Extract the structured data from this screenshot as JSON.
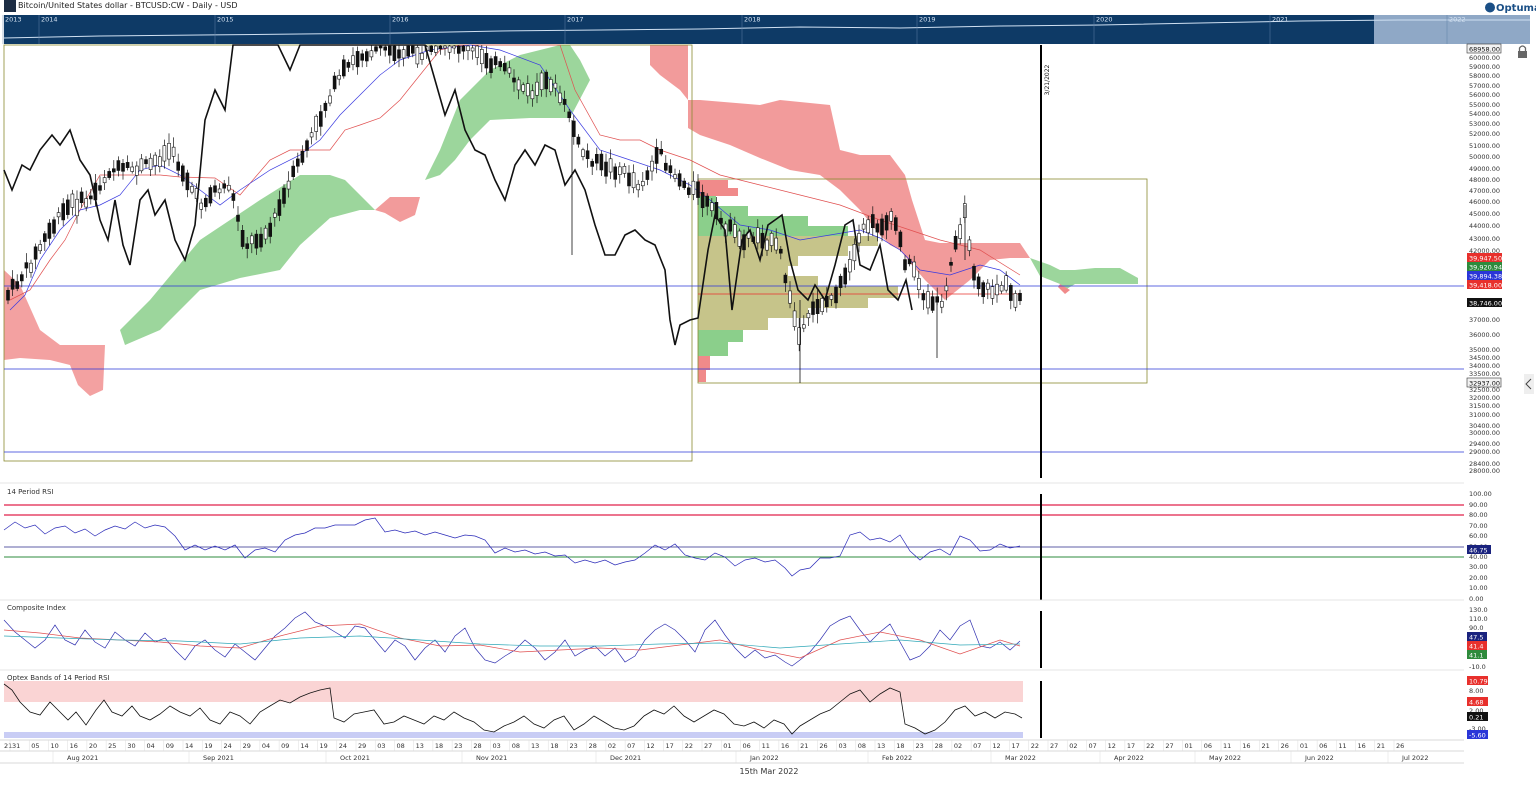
{
  "header": {
    "title": "Bitcoin/United States dollar - BTCUSD:CW - Daily - USD",
    "brand": "Optuma"
  },
  "navigator": {
    "years": [
      "2013",
      "2014",
      "2015",
      "2016",
      "2017",
      "2018",
      "2019",
      "2020",
      "2021",
      "2022"
    ]
  },
  "price_panel": {
    "vline_label": "3/21/2022",
    "top_label": "68958.00",
    "box_low_label": "32937.00",
    "price_ticks": [
      "60000.00",
      "59000.00",
      "58000.00",
      "57000.00",
      "56000.00",
      "55000.00",
      "54000.00",
      "53000.00",
      "52000.00",
      "51000.00",
      "50000.00",
      "49000.00",
      "48000.00",
      "47000.00",
      "46000.00",
      "45000.00",
      "44000.00",
      "43000.00",
      "42000.00",
      "37000.00",
      "36000.00",
      "35000.00",
      "34500.00",
      "34000.00",
      "33500.00",
      "32500.00",
      "32000.00",
      "31500.00",
      "31000.00",
      "30400.00",
      "30000.00",
      "29400.00",
      "29000.00",
      "28400.00",
      "28000.00"
    ],
    "markers": [
      {
        "value": "39,947.50",
        "color": "#e8302c"
      },
      {
        "value": "39,920.94",
        "color": "#2e8b3c"
      },
      {
        "value": "39,894.38",
        "color": "#2a36d8"
      },
      {
        "value": "39,418.00",
        "color": "#e8302c"
      },
      {
        "value": "38,746.00",
        "color": "#111111"
      }
    ]
  },
  "rsi_panel": {
    "title": "14 Period RSI",
    "ticks": [
      "100.00",
      "90.00",
      "80.00",
      "70.00",
      "60.00",
      "50.00",
      "40.00",
      "30.00",
      "20.00",
      "10.00",
      "0.00"
    ],
    "marker": "46.75"
  },
  "composite_panel": {
    "title": "Composite Index",
    "ticks": [
      "130.0",
      "110.0",
      "90.0",
      "70.0",
      "50.0",
      "30.0",
      "10.0",
      "-10.0"
    ],
    "markers": [
      {
        "value": "47.5",
        "color": "#1a237e"
      },
      {
        "value": "41.4",
        "color": "#e8302c"
      },
      {
        "value": "41.1",
        "color": "#2e8b3c"
      }
    ]
  },
  "optex_panel": {
    "title": "Optex Bands of 14 Period RSI",
    "ticks": [
      "8.00",
      "2.00",
      "-3.00"
    ],
    "markers": [
      {
        "value": "10.79",
        "color": "#e8302c"
      },
      {
        "value": "4.68",
        "color": "#e8302c"
      },
      {
        "value": "0.21",
        "color": "#111111"
      },
      {
        "value": "-5.60",
        "color": "#2a36d8"
      }
    ]
  },
  "date_axis": {
    "days": [
      "31",
      "05",
      "10",
      "16",
      "20",
      "25",
      "30",
      "04",
      "09",
      "14",
      "19",
      "24",
      "29",
      "04",
      "09",
      "14",
      "19",
      "24",
      "29",
      "03",
      "08",
      "13",
      "18",
      "23",
      "28",
      "03",
      "08",
      "13",
      "18",
      "23",
      "28",
      "02",
      "07",
      "12",
      "17",
      "22",
      "27",
      "01",
      "06",
      "11",
      "16",
      "21",
      "26",
      "03",
      "08",
      "13",
      "18",
      "23",
      "28",
      "02",
      "07",
      "12",
      "17",
      "22",
      "27",
      "02",
      "07",
      "12",
      "17",
      "22",
      "27",
      "01",
      "06",
      "11",
      "16",
      "21",
      "26",
      "01",
      "06",
      "11",
      "16",
      "21",
      "26"
    ],
    "months": [
      "Aug 2021",
      "Sep 2021",
      "Oct 2021",
      "Nov 2021",
      "Dec 2021",
      "Jan 2022",
      "Feb 2022",
      "Mar 2022",
      "Apr 2022",
      "May 2022",
      "Jun 2022",
      "Jul 2022"
    ],
    "left_cut": "21",
    "footer": "15th Mar 2022"
  },
  "chart_data": {
    "type": "candlestick",
    "title": "Bitcoin/United States dollar - BTCUSD:CW - Daily - USD",
    "series": [
      {
        "name": "BTCUSD",
        "approx_close": [
          [
            "2021-08-01",
            39800
          ],
          [
            "2021-08-10",
            45500
          ],
          [
            "2021-08-20",
            47000
          ],
          [
            "2021-08-31",
            47100
          ],
          [
            "2021-09-06",
            52000
          ],
          [
            "2021-09-07",
            46800
          ],
          [
            "2021-09-20",
            43000
          ],
          [
            "2021-09-30",
            43800
          ],
          [
            "2021-10-06",
            55000
          ],
          [
            "2021-10-20",
            64000
          ],
          [
            "2021-11-10",
            65000
          ],
          [
            "2021-11-20",
            58000
          ],
          [
            "2021-12-04",
            49000
          ],
          [
            "2021-12-15",
            48500
          ],
          [
            "2021-12-27",
            50500
          ],
          [
            "2022-01-10",
            41800
          ],
          [
            "2022-01-22",
            35000
          ],
          [
            "2022-02-01",
            38500
          ],
          [
            "2022-02-10",
            43500
          ],
          [
            "2022-02-24",
            38300
          ],
          [
            "2022-03-02",
            44400
          ],
          [
            "2022-03-07",
            38000
          ],
          [
            "2022-03-15",
            39300
          ]
        ]
      },
      {
        "name": "RSI 14",
        "last": 46.75,
        "upper_levels": [
          90,
          80
        ],
        "lower_level": 40
      },
      {
        "name": "Composite Index",
        "last": [
          47.5,
          41.4,
          41.1
        ]
      },
      {
        "name": "Optex Bands",
        "last": [
          10.79,
          4.68,
          0.21,
          -5.6
        ]
      }
    ],
    "horizontal_levels": [
      38746,
      34000,
      29000
    ],
    "volume_profile_box": {
      "low": 32937,
      "high": 48000,
      "from": "2022-01-01",
      "to": "2022-05-01"
    },
    "vertical_line": "2022-03-21",
    "ylim": [
      28000,
      68958
    ]
  }
}
